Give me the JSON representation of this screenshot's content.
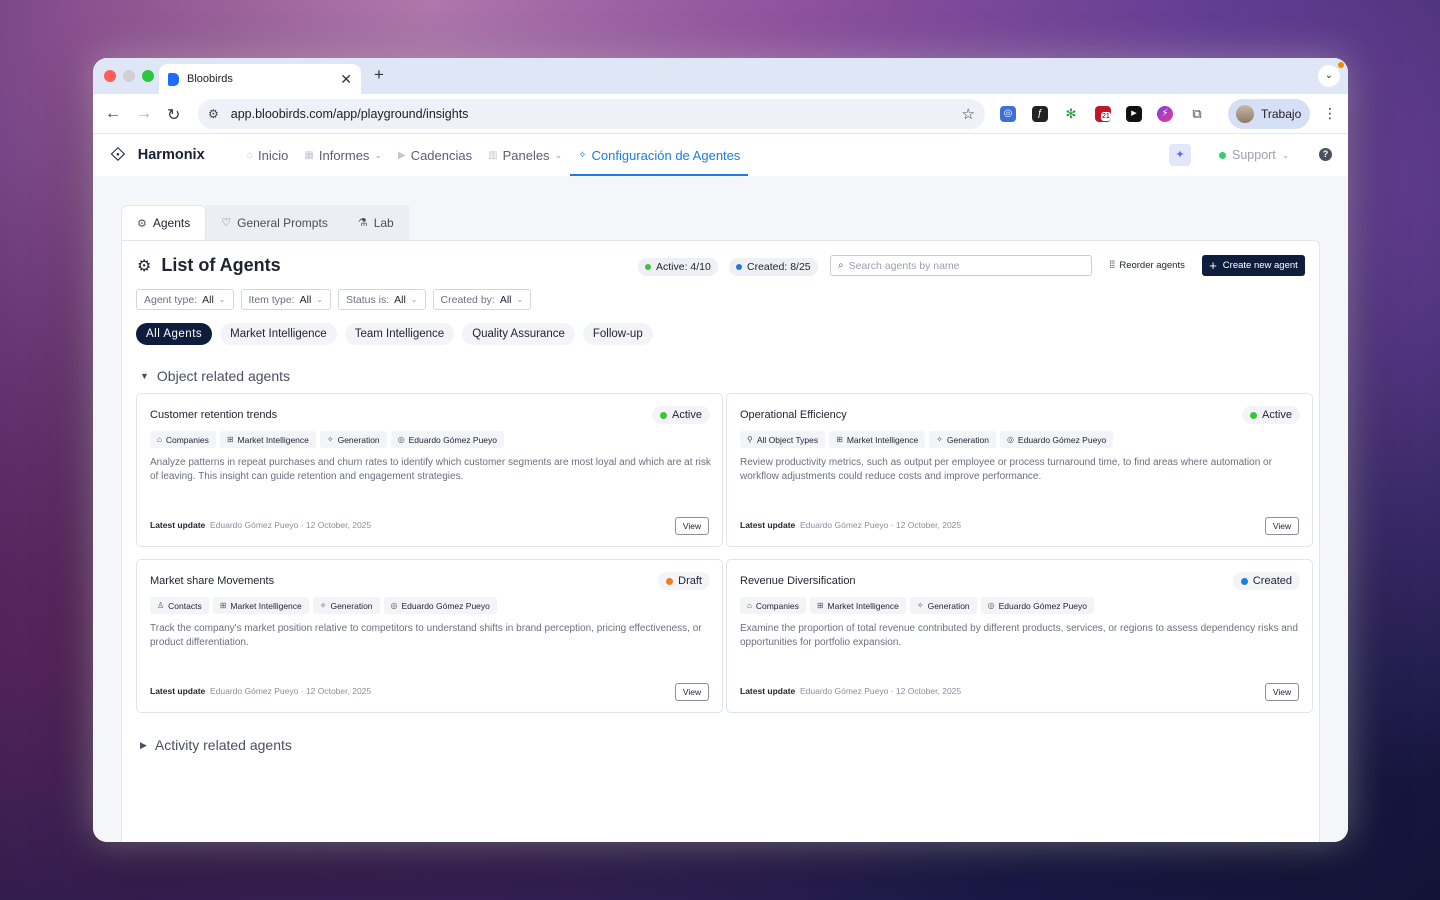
{
  "browser": {
    "tab_title": "Bloobirds",
    "url": "app.bloobirds.com/app/playground/insights",
    "profile_name": "Trabajo",
    "extension_badge": "21"
  },
  "app": {
    "brand": "Harmonix",
    "nav": [
      {
        "label": "Inicio",
        "icon": "home-icon"
      },
      {
        "label": "Informes",
        "icon": "report-icon",
        "dropdown": true
      },
      {
        "label": "Cadencias",
        "icon": "play-icon"
      },
      {
        "label": "Paneles",
        "icon": "building-icon",
        "dropdown": true
      },
      {
        "label": "Configuración de Agentes",
        "icon": "wand-icon",
        "active": true
      }
    ],
    "support_label": "Support"
  },
  "subtabs": [
    {
      "label": "Agents",
      "icon": "agents-icon",
      "active": true
    },
    {
      "label": "General Prompts",
      "icon": "prompt-icon"
    },
    {
      "label": "Lab",
      "icon": "flask-icon"
    }
  ],
  "panel": {
    "title": "List of Agents",
    "active_count": "Active: 4/10",
    "created_count": "Created: 8/25",
    "search_placeholder": "Search agents by name",
    "reorder_label": "Reorder agents",
    "create_label": "Create new agent"
  },
  "filters": [
    {
      "label": "Agent type:",
      "value": "All"
    },
    {
      "label": "Item type:",
      "value": "All"
    },
    {
      "label": "Status is:",
      "value": "All"
    },
    {
      "label": "Created by:",
      "value": "All"
    }
  ],
  "categories": [
    {
      "label": "All Agents",
      "active": true
    },
    {
      "label": "Market Intelligence"
    },
    {
      "label": "Team Intelligence"
    },
    {
      "label": "Quality Assurance"
    },
    {
      "label": "Follow-up"
    }
  ],
  "sections": {
    "object_related": "Object related agents",
    "activity_related": "Activity related agents"
  },
  "colors": {
    "active": "#3cc33c",
    "draft": "#f07c2a",
    "created": "#1e7be0",
    "accent": "#1e7be0",
    "primary_dark": "#0f1d3d"
  },
  "latest_update_label": "Latest update",
  "view_label": "View",
  "cards": [
    {
      "title": "Customer retention trends",
      "status": "Active",
      "status_color": "#3cc33c",
      "tags": [
        {
          "label": "Companies",
          "icon": "building-icon"
        },
        {
          "label": "Market Intelligence",
          "icon": "grid-icon"
        },
        {
          "label": "Generation",
          "icon": "sparkle-icon"
        },
        {
          "label": "Eduardo Gómez Pueyo",
          "icon": "user-circle-icon"
        }
      ],
      "description": "Analyze patterns in repeat purchases and churn rates to identify which customer segments are most loyal and which are at risk of leaving. This insight can guide retention and engagement strategies.",
      "update": "Eduardo Gómez Pueyo · 12 October, 2025"
    },
    {
      "title": "Operational Efficiency",
      "status": "Active",
      "status_color": "#3cc33c",
      "tags": [
        {
          "label": "All Object Types",
          "icon": "objects-icon"
        },
        {
          "label": "Market Intelligence",
          "icon": "grid-icon"
        },
        {
          "label": "Generation",
          "icon": "sparkle-icon"
        },
        {
          "label": "Eduardo Gómez Pueyo",
          "icon": "user-circle-icon"
        }
      ],
      "description": "Review productivity metrics, such as output per employee or process turnaround time, to find areas where automation or workflow adjustments could reduce costs and improve performance.",
      "update": "Eduardo Gómez Pueyo · 12 October, 2025"
    },
    {
      "title": "Market share Movements",
      "status": "Draft",
      "status_color": "#f07c2a",
      "tags": [
        {
          "label": "Contacts",
          "icon": "person-icon"
        },
        {
          "label": "Market Intelligence",
          "icon": "grid-icon"
        },
        {
          "label": "Generation",
          "icon": "sparkle-icon"
        },
        {
          "label": "Eduardo Gómez Pueyo",
          "icon": "user-circle-icon"
        }
      ],
      "description": "Track the company's market position relative to competitors to understand shifts in brand perception, pricing effectiveness, or product differentiation.",
      "update": "Eduardo Gómez Pueyo · 12 October, 2025"
    },
    {
      "title": "Revenue Diversification",
      "status": "Created",
      "status_color": "#1e7be0",
      "tags": [
        {
          "label": "Companies",
          "icon": "building-icon"
        },
        {
          "label": "Market Intelligence",
          "icon": "grid-icon"
        },
        {
          "label": "Generation",
          "icon": "sparkle-icon"
        },
        {
          "label": "Eduardo Gómez Pueyo",
          "icon": "user-circle-icon"
        }
      ],
      "description": "Examine the proportion of total revenue contributed by different products, services, or regions to assess dependency risks and opportunities for portfolio expansion.",
      "update": "Eduardo Gómez Pueyo · 12 October, 2025"
    }
  ]
}
